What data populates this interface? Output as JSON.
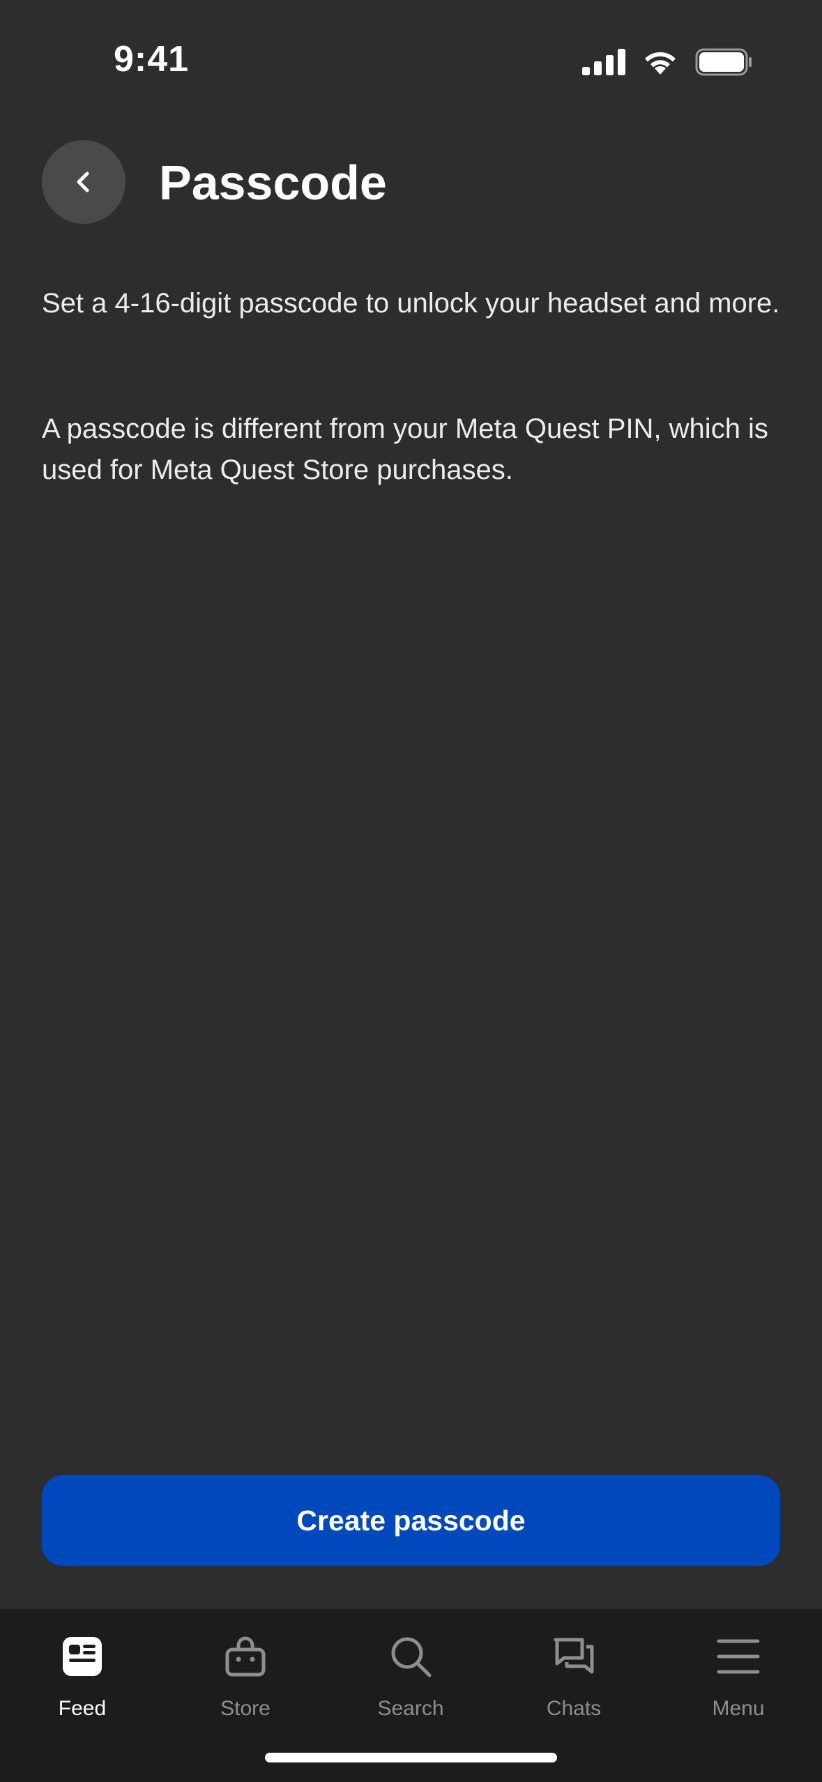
{
  "status_bar": {
    "time": "9:41",
    "icons": [
      "cellular-signal-icon",
      "wifi-icon",
      "battery-icon"
    ]
  },
  "header": {
    "back_icon": "chevron-left-icon",
    "title": "Passcode"
  },
  "content": {
    "paragraph_1": "Set a 4-16-digit passcode to unlock your headset and more.",
    "paragraph_2": "A passcode is different from your Meta Quest PIN, which is used for Meta Quest Store purchases."
  },
  "primary_action": {
    "label": "Create passcode"
  },
  "tab_bar": {
    "tabs": [
      {
        "label": "Feed",
        "icon": "feed-icon",
        "active": true
      },
      {
        "label": "Store",
        "icon": "store-bag-icon",
        "active": false
      },
      {
        "label": "Search",
        "icon": "search-icon",
        "active": false
      },
      {
        "label": "Chats",
        "icon": "chats-icon",
        "active": false
      },
      {
        "label": "Menu",
        "icon": "menu-icon",
        "active": false
      }
    ]
  },
  "colors": {
    "background": "#2d2d2e",
    "primary_button": "#0049bd",
    "back_button": "#4a4a4c",
    "tab_bar": "#1c1c1d",
    "tab_inactive": "#8e8e90",
    "tab_active": "#ffffff"
  }
}
